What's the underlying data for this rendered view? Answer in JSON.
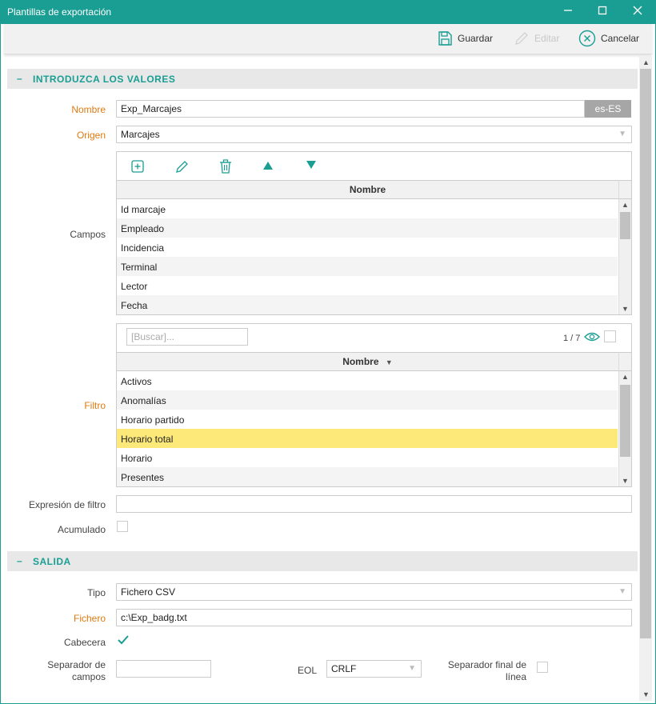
{
  "window": {
    "title": "Plantillas de exportación"
  },
  "toolbar": {
    "save": "Guardar",
    "edit": "Editar",
    "cancel": "Cancelar"
  },
  "section_values": {
    "collapse": "–",
    "title": "INTRODUZCA LOS VALORES"
  },
  "form": {
    "nombre_label": "Nombre",
    "nombre_value": "Exp_Marcajes",
    "lang": "es-ES",
    "origen_label": "Origen",
    "origen_value": "Marcajes",
    "campos_label": "Campos",
    "filtro_label": "Filtro",
    "expresion_label": "Expresión de filtro",
    "acumulado_label": "Acumulado"
  },
  "campos": {
    "header": "Nombre",
    "rows": [
      "Id marcaje",
      "Empleado",
      "Incidencia",
      "Terminal",
      "Lector",
      "Fecha"
    ]
  },
  "filtro": {
    "search_placeholder": "[Buscar]...",
    "pager": "1 / 7",
    "header": "Nombre",
    "sort_icon": "▼",
    "rows": [
      "Activos",
      "Anomalías",
      "Horario partido",
      "Horario total",
      "Horario",
      "Presentes"
    ],
    "selected_index": 3
  },
  "section_output": {
    "collapse": "–",
    "title": "SALIDA"
  },
  "output": {
    "tipo_label": "Tipo",
    "tipo_value": "Fichero CSV",
    "fichero_label": "Fichero",
    "fichero_value": "c:\\Exp_badg.txt",
    "cabecera_label": "Cabecera",
    "sep_campos_label_1": "Separador de",
    "sep_campos_label_2": "campos",
    "eol_label": "EOL",
    "eol_value": "CRLF",
    "sep_final_label_1": "Separador final de",
    "sep_final_label_2": "línea"
  },
  "colors": {
    "accent": "#1a9e93",
    "required": "#e07a10",
    "selected_row": "#fde97a"
  }
}
